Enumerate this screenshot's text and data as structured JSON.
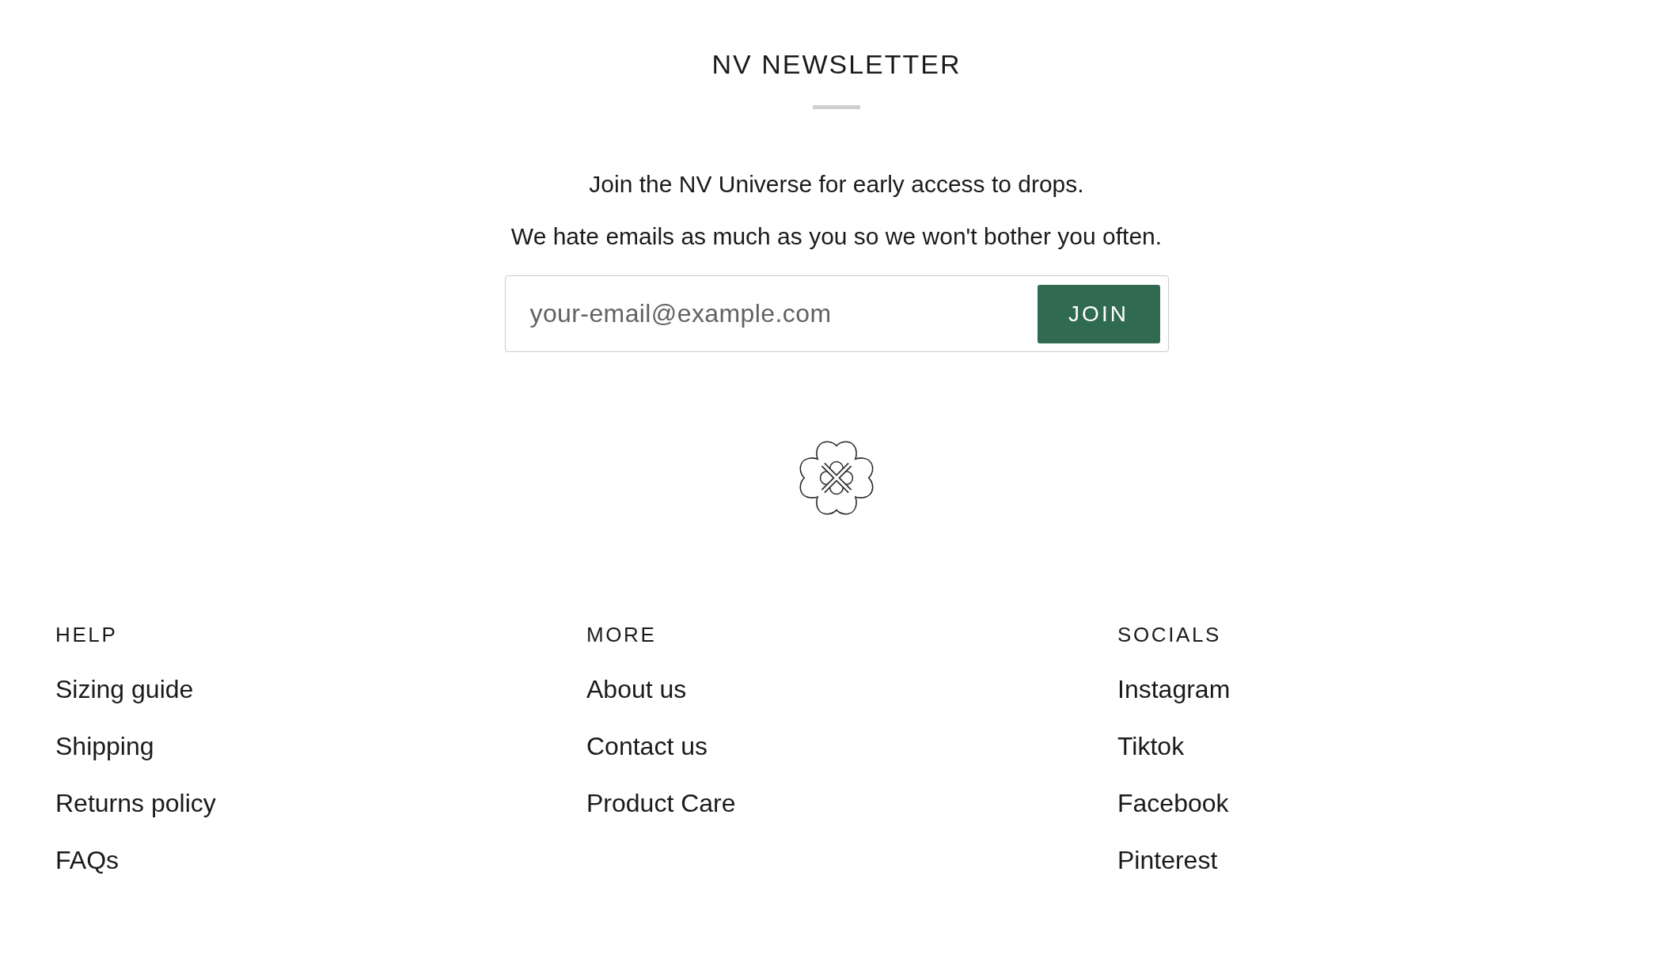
{
  "newsletter": {
    "title": "NV NEWSLETTER",
    "lines": [
      "Join the NV Universe for early access to drops.",
      "We hate emails as much as you so we won't bother you often."
    ],
    "email_field": {
      "placeholder": "your-email@example.com"
    },
    "button": "JOIN"
  },
  "footer": {
    "columns": [
      {
        "heading": "HELP",
        "links": [
          "Sizing guide",
          "Shipping",
          "Returns policy",
          "FAQs"
        ]
      },
      {
        "heading": "MORE",
        "links": [
          "About us",
          "Contact us",
          "Product Care"
        ]
      },
      {
        "heading": "SOCIALS",
        "links": [
          "Instagram",
          "Tiktok",
          "Facebook",
          "Pinterest"
        ]
      }
    ]
  }
}
